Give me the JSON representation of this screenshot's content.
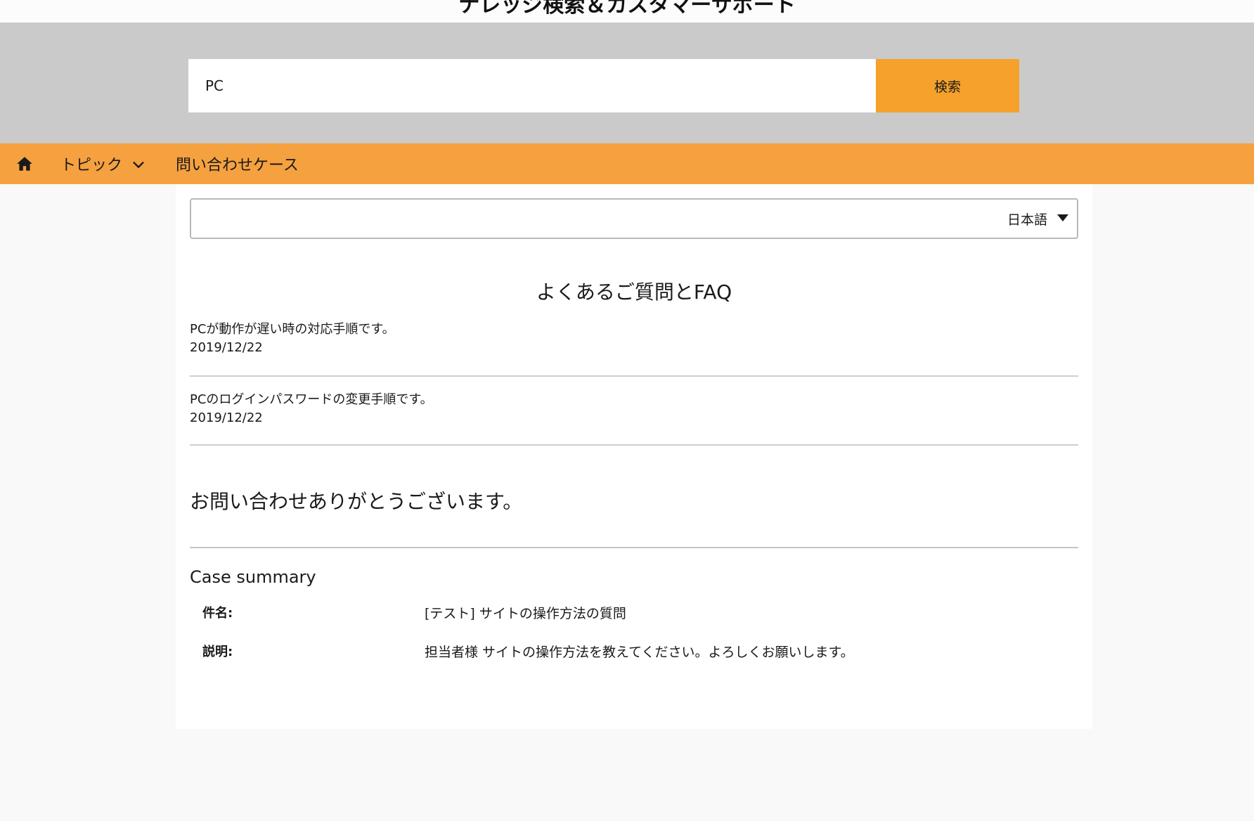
{
  "header": {
    "title": "ナレッジ検索＆カスタマーサポート"
  },
  "search": {
    "value": "PC",
    "button_label": "検索"
  },
  "nav": {
    "home_icon": "home-icon",
    "topics_label": "トピック",
    "cases_label": "問い合わせケース"
  },
  "language": {
    "selected": "日本語"
  },
  "faq": {
    "heading": "よくあるご質問とFAQ",
    "items": [
      {
        "title": "PCが動作が遅い時の対応手順です。",
        "date": "2019/12/22"
      },
      {
        "title": "PCのログインパスワードの変更手順です。",
        "date": "2019/12/22"
      }
    ]
  },
  "confirmation": {
    "message": "お問い合わせありがとうございます。"
  },
  "case_summary": {
    "title": "Case summary",
    "subject_label": "件名:",
    "subject_value": "[テスト] サイトの操作方法の質問",
    "description_label": "説明:",
    "description_value": "担当者様 サイトの操作方法を教えてください。よろしくお願いします。"
  },
  "colors": {
    "accent": "#f5a13f",
    "search_button": "#f5a12b",
    "search_band": "#c9cac9"
  }
}
